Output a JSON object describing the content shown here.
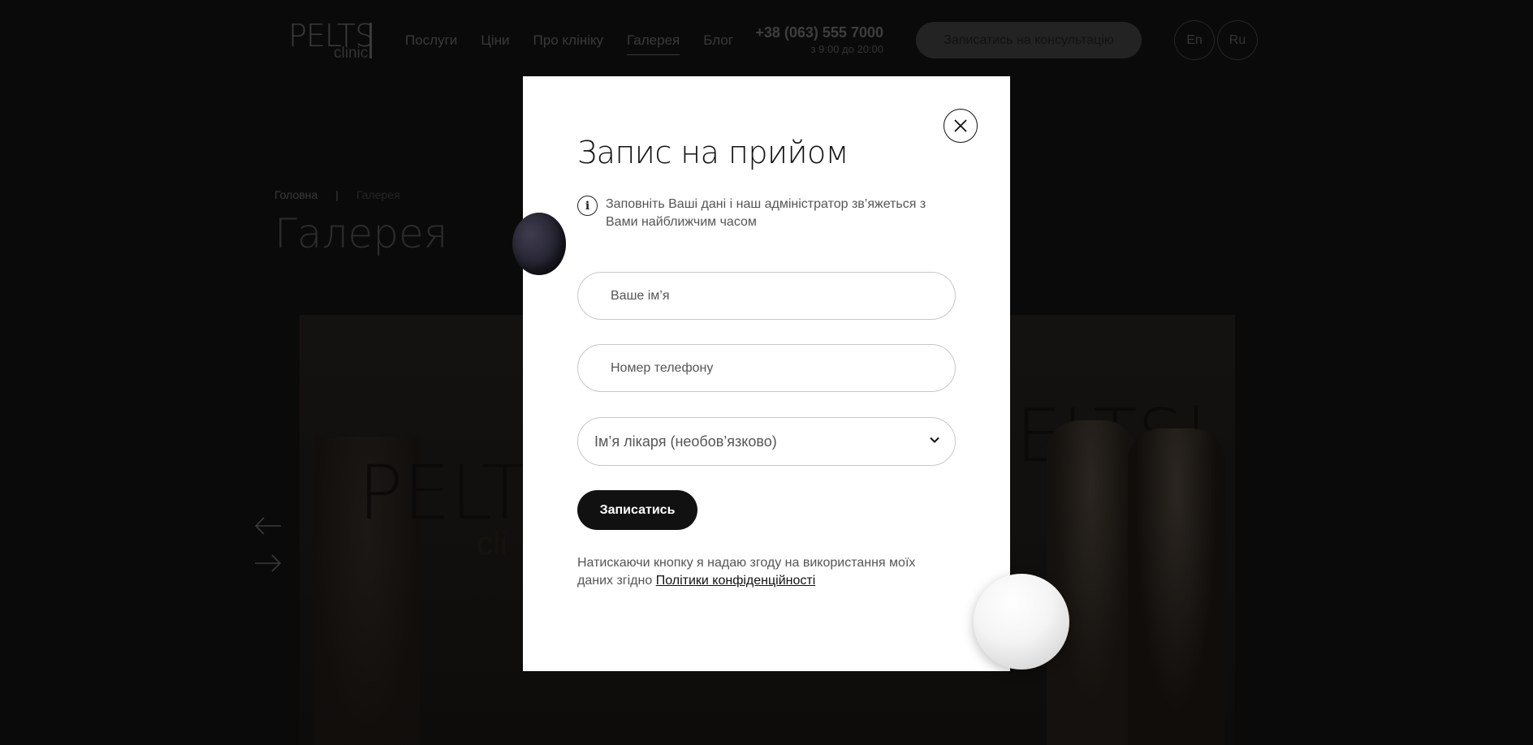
{
  "header": {
    "logo_text": "PELTS",
    "logo_sub": "clinic",
    "nav": [
      {
        "label": "Послуги"
      },
      {
        "label": "Ціни"
      },
      {
        "label": "Про клініку"
      },
      {
        "label": "Галерея"
      },
      {
        "label": "Блог"
      }
    ],
    "active_nav": "Галерея",
    "phone": "+38 (063) 555 7000",
    "hours": "з 9:00 до 20:00",
    "cta_label": "Записатись на консультацію",
    "lang_en": "En",
    "lang_ru": "Ru"
  },
  "breadcrumb": {
    "home": "Головна",
    "separator": "|",
    "current": "Галерея"
  },
  "page": {
    "title": "Галерея"
  },
  "modal": {
    "title": "Запис на прийом",
    "info_text": "Заповніть Ваші дані і наш адміністратор зв’яжеться з Вами найближчим часом",
    "name_placeholder": "Ваше ім’я",
    "name_value": "",
    "phone_placeholder": "Номер телефону",
    "phone_value": "",
    "doctor_select_value": "Ім’я лікаря (необов’язково)",
    "submit_label": "Записатись",
    "consent_prefix": "Натискаючи кнопку я надаю згоду на використання моїх даних згідно",
    "consent_link": "Політики конфіденційності"
  },
  "icons": {
    "close": "close-icon",
    "info": "info-icon",
    "chevron": "chevron-down-icon",
    "prev": "arrow-left-icon",
    "next": "arrow-right-icon"
  },
  "colors": {
    "overlay_bg": "#0a0a0a",
    "modal_bg": "#ffffff",
    "button_bg": "#111111",
    "accent_text": "#111111"
  }
}
